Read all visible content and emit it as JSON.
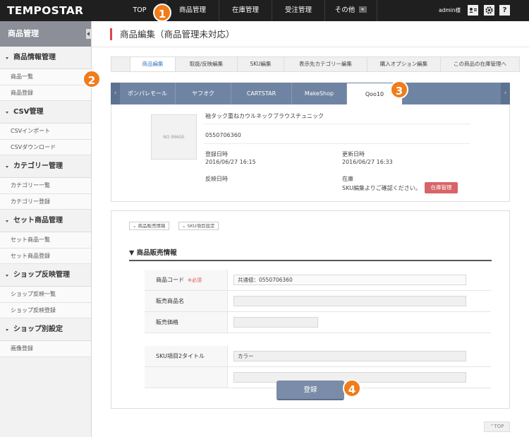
{
  "header": {
    "logo": "TEMPOSTAR",
    "nav": [
      {
        "label": "TOP"
      },
      {
        "label": "商品管理"
      },
      {
        "label": "在庫管理"
      },
      {
        "label": "受注管理"
      },
      {
        "label": "その他"
      }
    ],
    "user": "admin様",
    "icons": [
      "user-card-icon",
      "gear-icon",
      "help-icon"
    ],
    "help_glyph": "?"
  },
  "sidebar": {
    "title": "商品管理",
    "sections": [
      {
        "title": "商品情報管理",
        "items": [
          "商品一覧",
          "商品登録"
        ]
      },
      {
        "title": "CSV管理",
        "items": [
          "CSVインポート",
          "CSVダウンロード"
        ]
      },
      {
        "title": "カテゴリー管理",
        "items": [
          "カテゴリー一覧",
          "カテゴリー登録"
        ]
      },
      {
        "title": "セット商品管理",
        "items": [
          "セット商品一覧",
          "セット商品登録"
        ]
      },
      {
        "title": "ショップ反映管理",
        "items": [
          "ショップ反映一覧",
          "ショップ反映登録"
        ]
      },
      {
        "title": "ショップ別設定",
        "items": [
          "画像登録"
        ]
      }
    ]
  },
  "page": {
    "title": "商品編集（商品管理未対応）"
  },
  "tabs": [
    "商品編集",
    "取扱/反映編集",
    "SKU編集",
    "表示先カテゴリー編集",
    "購入オプション編集",
    "この商品の在庫管理へ"
  ],
  "shop_tabs": [
    "ポンパレモール",
    "ヤフオク",
    "CARTSTAR",
    "MakeShop",
    "Qoo10"
  ],
  "product": {
    "no_image": "NO IMAGE",
    "name": "袖タック重ねカウルネックブラウスチュニック",
    "code": "0550706360",
    "registered_label": "登録日時",
    "registered": "2016/06/27 16:15",
    "updated_label": "更新日時",
    "updated": "2016/06/27 16:33",
    "reflect_label": "反映日時",
    "stock_label": "在庫",
    "stock_note": "SKU編集よりご確認ください。",
    "stock_button": "在庫管理"
  },
  "form": {
    "toggles": [
      "商品販売情報",
      "SKU項目設定"
    ],
    "section_title": "▼ 商品販売情報",
    "rows": [
      {
        "label": "商品コード",
        "required": "※必須",
        "value": "共通値：0550706360"
      },
      {
        "label": "販売商品名",
        "value": ""
      },
      {
        "label": "販売価格",
        "value": ""
      },
      {
        "label": "SKU項目2タイトル",
        "value": "カラー"
      }
    ],
    "submit": "登録"
  },
  "badges": [
    "1",
    "2",
    "3",
    "4"
  ],
  "to_top": "TOP",
  "colors": {
    "accent": "#f07c1a",
    "header": "#1f1f1f",
    "shop_bar": "#6f84a3",
    "title_mark": "#e0454b",
    "stock_button": "#d8646a"
  }
}
